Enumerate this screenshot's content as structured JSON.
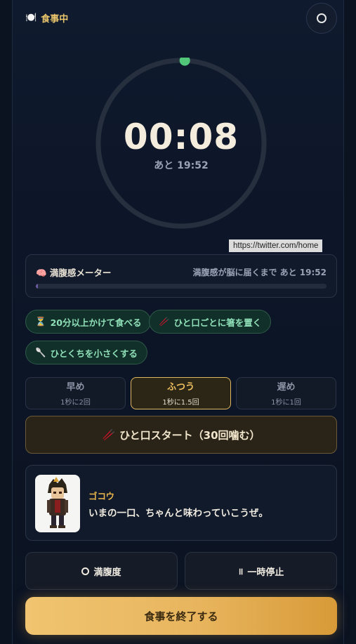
{
  "header": {
    "icon": "plate-icon",
    "label": "食事中"
  },
  "timer": {
    "elapsed": "00:08",
    "remaining": "あと 19:52",
    "progress": 0.007
  },
  "tooltip": {
    "url": "https://twitter.com/home"
  },
  "meter": {
    "label": "満腹感メーター",
    "note": "満腹感が脳に届くまで あと 19:52",
    "fill": 0.007
  },
  "tips": [
    {
      "icon": "⏳",
      "label": "20分以上かけて食べる"
    },
    {
      "icon": "🥢",
      "label": "ひと口ごとに箸を置く"
    },
    {
      "icon": "🥄",
      "label": "ひとくちを小さくする"
    }
  ],
  "speeds": [
    {
      "title": "早め",
      "sub": "1秒に2回",
      "active": false
    },
    {
      "title": "ふつう",
      "sub": "1秒に1.5回",
      "active": true
    },
    {
      "title": "遅め",
      "sub": "1秒に1回",
      "active": false
    }
  ],
  "start_button": {
    "label": "ひと口スタート（30回噛む）"
  },
  "chat": {
    "name": "ゴコウ",
    "message": "いまの一口、ちゃんと味わっていこうぜ。"
  },
  "controls": {
    "fullness": "満腹度",
    "pause": "一時停止"
  },
  "end_button": {
    "label": "食事を終了する"
  },
  "colors": {
    "accent": "#e9c46a",
    "progress_dot": "#52c77a",
    "chip_text": "#8fe0b8"
  }
}
